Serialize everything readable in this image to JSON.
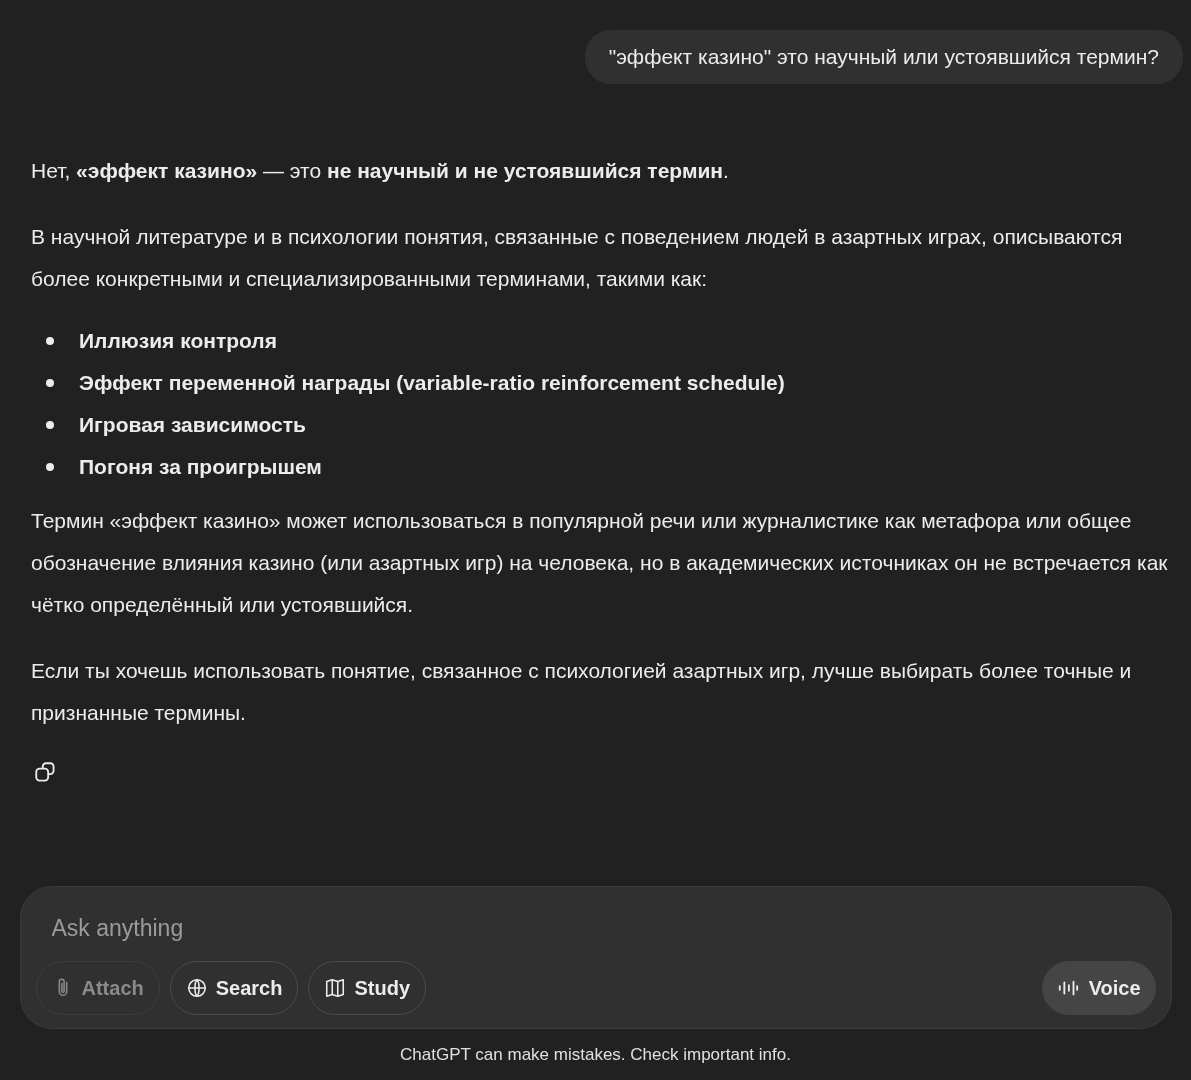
{
  "user_message": "\"эффект казино\" это научный или устоявшийся термин?",
  "answer": {
    "paragraphs_before": [
      "Нет, **«эффект казино»** — это **не научный и не устоявшийся термин**.",
      "В научной литературе и в психологии понятия, связанные с поведением людей в азартных играх, описываются более конкретными и специализированными терминами, такими как:"
    ],
    "bullets": [
      "Иллюзия контроля",
      "Эффект переменной награды (variable-ratio reinforcement schedule)",
      "Игровая зависимость",
      "Погоня за проигрышем"
    ],
    "paragraphs_after": [
      "Термин «эффект казино» может использоваться в популярной речи или журналистике как метафора или общее обозначение влияния казино (или азартных игр) на человека, но в академических источниках он не встречается как чётко определённый или устоявшийся.",
      "Если ты хочешь использовать понятие, связанное с психологией азартных игр, лучше выбирать более точные и признанные термины."
    ]
  },
  "composer": {
    "placeholder": "Ask anything",
    "tools": [
      {
        "kind": "attach",
        "label": "Attach",
        "disabled": true
      },
      {
        "kind": "search",
        "label": "Search",
        "disabled": false
      },
      {
        "kind": "study",
        "label": "Study",
        "disabled": false
      }
    ],
    "voice": {
      "label": "Voice"
    }
  },
  "footer": "ChatGPT can make mistakes. Check important info."
}
